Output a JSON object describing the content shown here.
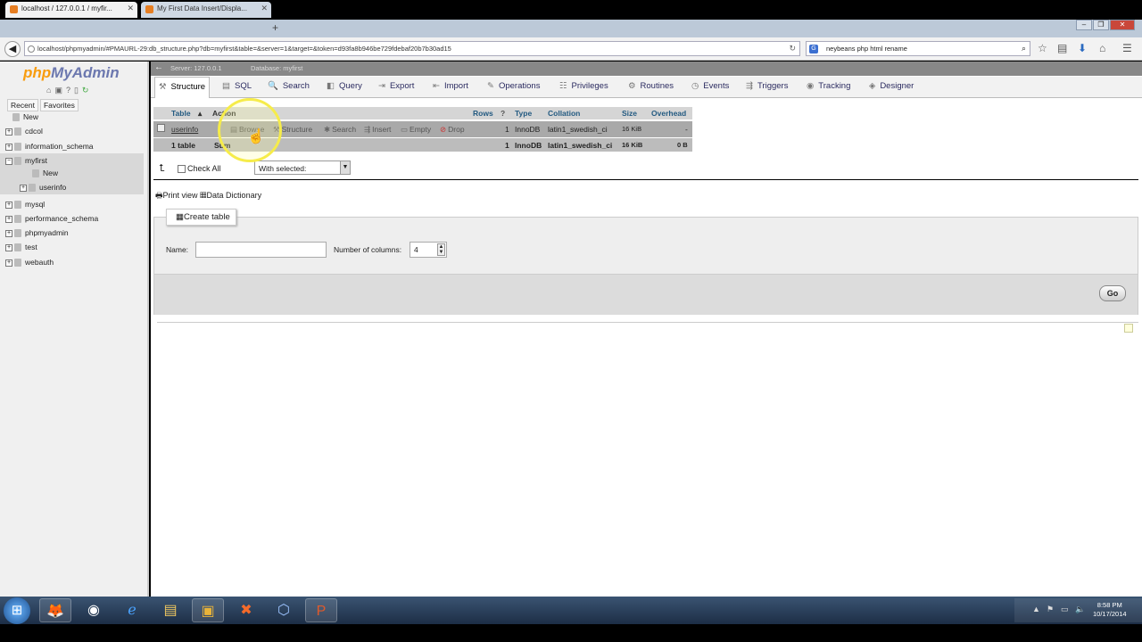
{
  "browser": {
    "tabs": [
      {
        "title": "localhost / 127.0.0.1 / myfir..."
      },
      {
        "title": "My First Data Insert/Displa..."
      }
    ],
    "new_tab": "+",
    "url": "localhost/phpmyadmin/#PMAURL-29:db_structure.php?db=myfirst&table=&server=1&target=&token=d93fa8b946be729fdebaf20b7b30ad15",
    "search_value": "neybeans php html rename",
    "search_engine": "G",
    "window_controls": {
      "minimize": "–",
      "maximize": "❐",
      "close": "✕"
    }
  },
  "sidebar": {
    "logo_php": "php",
    "logo_myadmin": "MyAdmin",
    "tabs": [
      "Recent",
      "Favorites"
    ],
    "items": [
      {
        "label": "New"
      },
      {
        "label": "cdcol"
      },
      {
        "label": "information_schema"
      },
      {
        "label": "myfirst"
      },
      {
        "label": "New"
      },
      {
        "label": "userinfo"
      },
      {
        "label": "mysql"
      },
      {
        "label": "performance_schema"
      },
      {
        "label": "phpmyadmin"
      },
      {
        "label": "test"
      },
      {
        "label": "webauth"
      }
    ]
  },
  "breadcrumb": {
    "server": "Server: 127.0.0.1",
    "database": "Database: myfirst"
  },
  "menu": {
    "tabs": [
      {
        "label": "Structure",
        "icon": "⚒"
      },
      {
        "label": "SQL",
        "icon": "▤"
      },
      {
        "label": "Search",
        "icon": "🔍"
      },
      {
        "label": "Query",
        "icon": "◧"
      },
      {
        "label": "Export",
        "icon": "⇥"
      },
      {
        "label": "Import",
        "icon": "⇤"
      },
      {
        "label": "Operations",
        "icon": "✎"
      },
      {
        "label": "Privileges",
        "icon": "☷"
      },
      {
        "label": "Routines",
        "icon": "⚙"
      },
      {
        "label": "Events",
        "icon": "◷"
      },
      {
        "label": "Triggers",
        "icon": "⇶"
      },
      {
        "label": "Tracking",
        "icon": "◉"
      },
      {
        "label": "Designer",
        "icon": "◈"
      }
    ]
  },
  "table": {
    "headers": {
      "table": "Table",
      "action": "Action",
      "rows": "Rows",
      "type": "Type",
      "collation": "Collation",
      "size": "Size",
      "overhead": "Overhead"
    },
    "row": {
      "name": "userinfo",
      "actions": [
        "Browse",
        "Structure",
        "Search",
        "Insert",
        "Empty",
        "Drop"
      ],
      "rows": "1",
      "type": "InnoDB",
      "collation": "latin1_swedish_ci",
      "size": "16 KiB",
      "overhead": "-"
    },
    "summary": {
      "count": "1 table",
      "label": "Sum",
      "rows": "1",
      "type": "InnoDB",
      "collation": "latin1_swedish_ci",
      "size": "16 KiB",
      "overhead": "0 B"
    }
  },
  "bulk": {
    "check_all": "Check All",
    "with_selected": "With selected:"
  },
  "links": {
    "print_view": "Print view",
    "data_dictionary": "Data Dictionary"
  },
  "create_table": {
    "legend": "Create table",
    "name_label": "Name:",
    "name_value": "",
    "columns_label": "Number of columns:",
    "columns_value": "4",
    "go": "Go"
  },
  "taskbar": {
    "clock_time": "8:58 PM",
    "clock_date": "10/17/2014"
  }
}
